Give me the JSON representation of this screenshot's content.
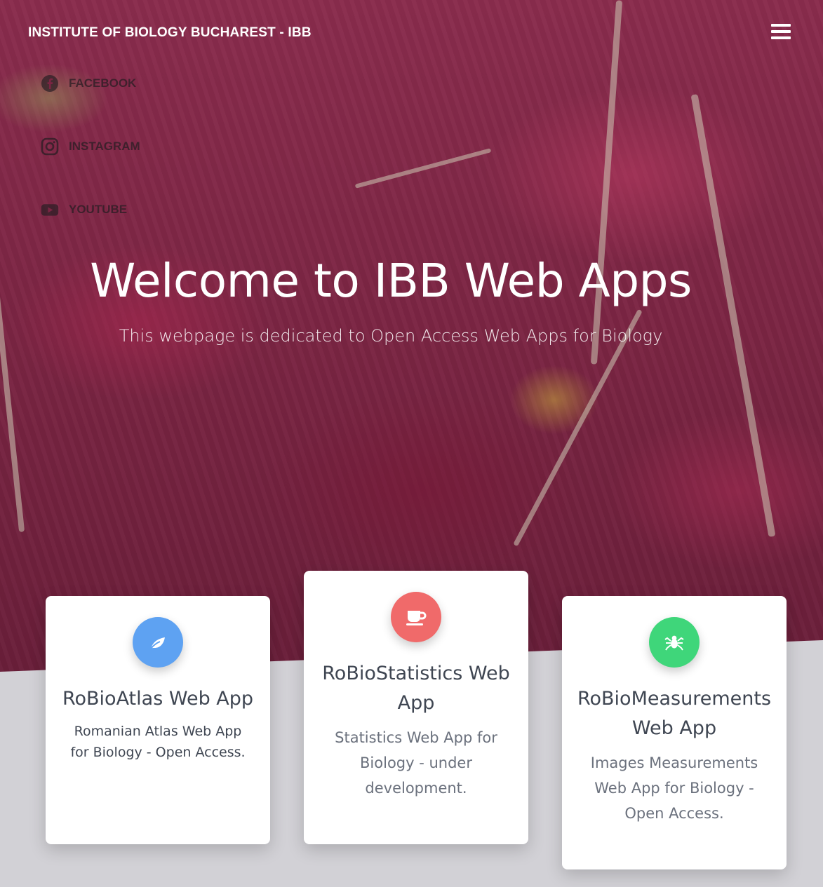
{
  "header": {
    "title": "INSTITUTE OF BIOLOGY BUCHAREST - IBB"
  },
  "social": [
    {
      "label": "FACEBOOK",
      "icon": "facebook-icon"
    },
    {
      "label": "INSTAGRAM",
      "icon": "instagram-icon"
    },
    {
      "label": "YOUTUBE",
      "icon": "youtube-icon"
    }
  ],
  "hero": {
    "title": "Welcome to IBB Web Apps",
    "subtitle": "This webpage is dedicated to Open Access Web Apps for Biology"
  },
  "cards": [
    {
      "title": "RoBioAtlas Web App",
      "description": "Romanian Atlas Web App for Biology - Open Access.",
      "icon": "leaf-icon",
      "color": "#5ea2f2"
    },
    {
      "title": "RoBioStatistics Web App",
      "description": "Statistics Web App for Biology - under development.",
      "icon": "coffee-cup-icon",
      "color": "#f06a6a"
    },
    {
      "title": "RoBioMeasurements Web App",
      "description": "Images Measurements Web App for Biology - Open Access.",
      "icon": "spider-icon",
      "color": "#3fd67a"
    }
  ]
}
